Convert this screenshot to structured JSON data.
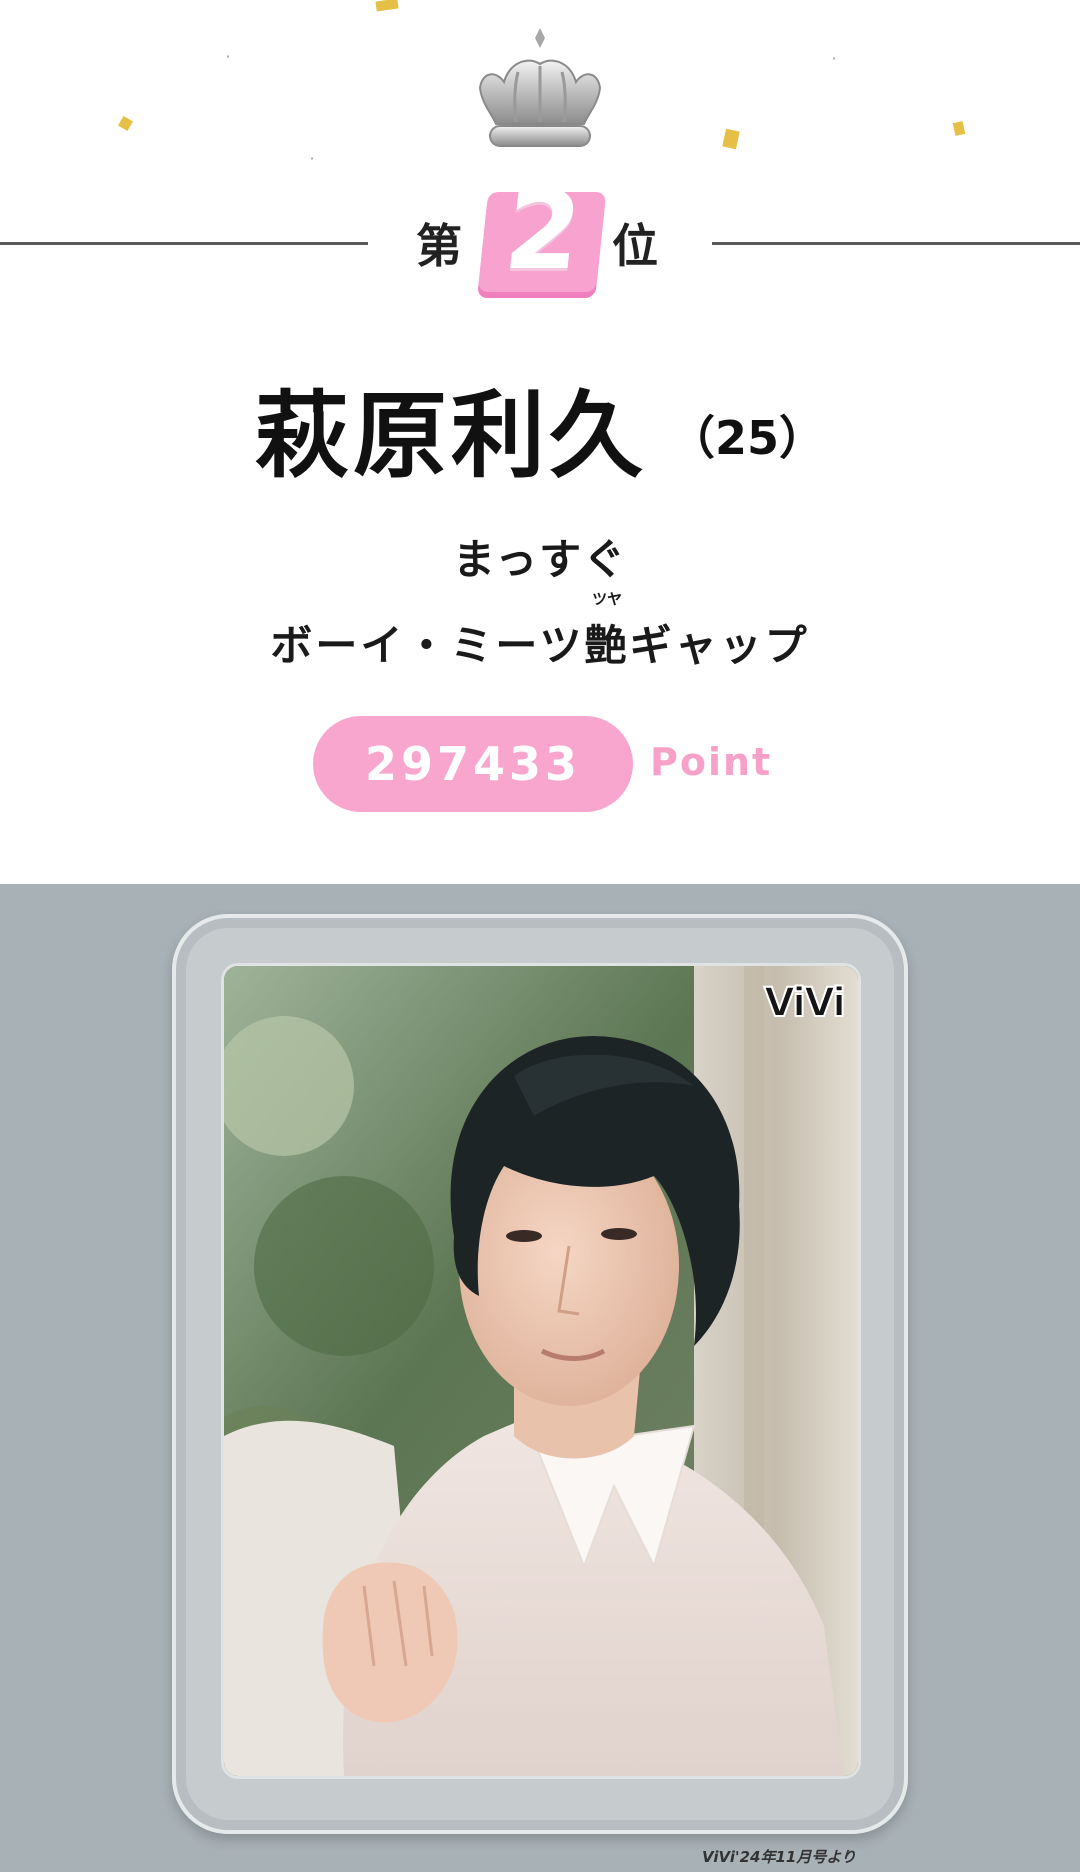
{
  "ranking": {
    "prefix": "第",
    "number": "2",
    "suffix": "位"
  },
  "person": {
    "name": "萩原利久",
    "age": "（25）"
  },
  "catchphrase": {
    "line1": "まっすぐ",
    "line2_before": "ボーイ・ミーツ",
    "line2_ruby_base": "艶",
    "line2_ruby_text": "ツヤ",
    "line2_after": "ギャップ"
  },
  "points": {
    "value": "297433",
    "unit": "Point"
  },
  "photo": {
    "logo": "ViVi",
    "credit": "ViVi'24年11月号より"
  },
  "colors": {
    "accent_pink": "#f9a6cf",
    "background_grey": "#a8b1b6",
    "confetti_gold": "#e6c046"
  },
  "icons": {
    "crown": "crown-icon"
  }
}
